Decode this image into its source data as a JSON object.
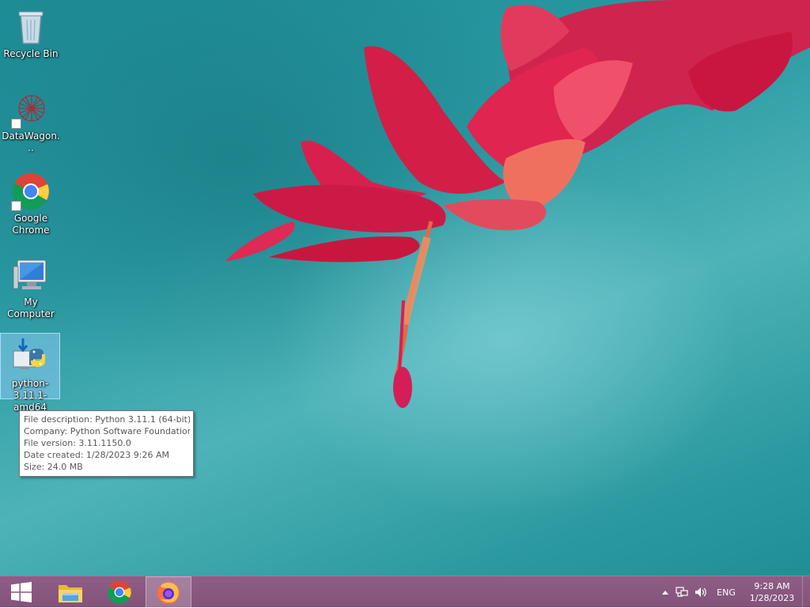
{
  "desktop": {
    "icons": [
      {
        "label": "Recycle Bin",
        "icon": "recycle-bin-icon"
      },
      {
        "label": "DataWagon...",
        "icon": "datawagon-icon"
      },
      {
        "label": "Google Chrome",
        "icon": "chrome-icon"
      },
      {
        "label": "My Computer",
        "icon": "computer-icon"
      },
      {
        "label": "python-3.11.1-amd64",
        "icon": "python-installer-icon"
      }
    ]
  },
  "tooltip": {
    "description": "File description: Python 3.11.1 (64-bit)",
    "company": "Company: Python Software Foundation",
    "version": "File version: 3.11.1150.0",
    "created": "Date created: 1/28/2023 9:26 AM",
    "size": "Size: 24.0 MB"
  },
  "taskbar": {
    "start_icon": "windows-logo-icon",
    "pinned": [
      {
        "name": "file-explorer",
        "icon": "folder-icon"
      },
      {
        "name": "chrome",
        "icon": "chrome-icon"
      },
      {
        "name": "firefox",
        "icon": "firefox-icon",
        "active": true
      }
    ],
    "tray": {
      "language": "ENG",
      "time": "9:28 AM",
      "date": "1/28/2023"
    }
  },
  "colors": {
    "taskbar": "#8a5882",
    "desktop_teal": "#2a9aa2",
    "selection": "#99d1ff"
  }
}
